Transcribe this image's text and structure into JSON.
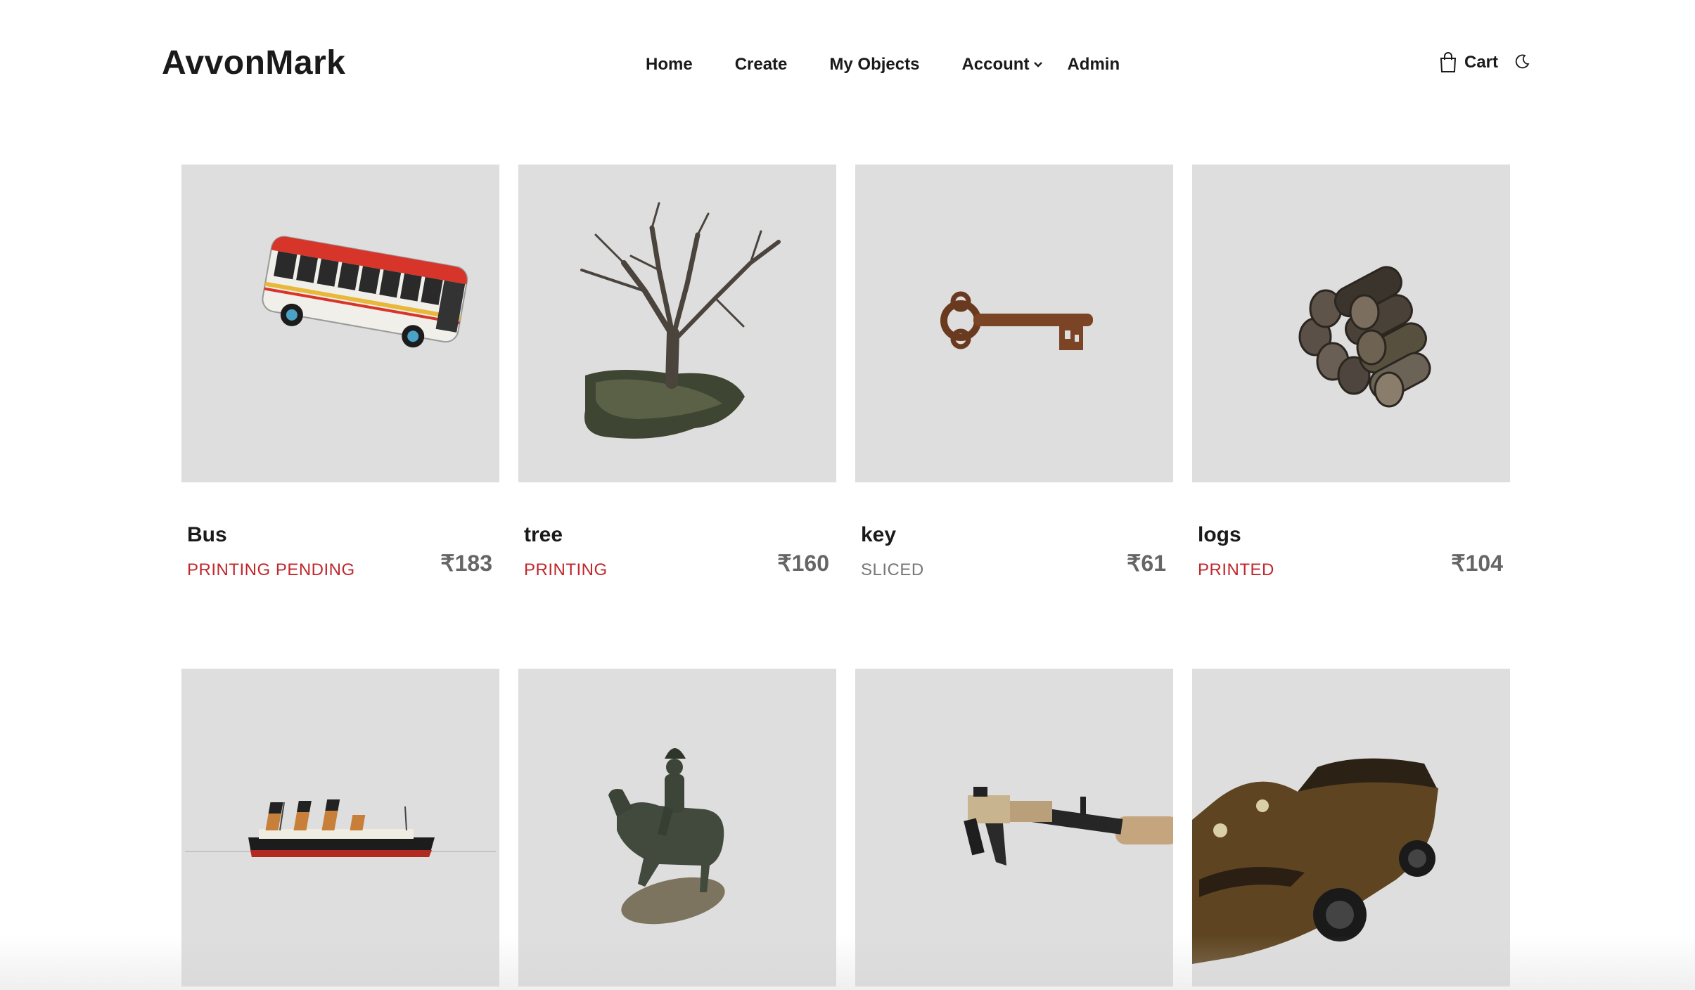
{
  "header": {
    "logo": "AvvonMark",
    "nav": [
      "Home",
      "Create",
      "My Objects",
      "Account",
      "Admin"
    ],
    "cart_label": "Cart",
    "theme_icon": "moon-icon"
  },
  "colors": {
    "status_red": "#c0282d",
    "status_gray": "#777777",
    "card_bg": "#dedede"
  },
  "objects": [
    {
      "title": "Bus",
      "status": "PRINTING PENDING",
      "price": "₹183",
      "icon": "bus-model"
    },
    {
      "title": "tree",
      "status": "PRINTING",
      "price": "₹160",
      "icon": "tree-model"
    },
    {
      "title": "key",
      "status": "SLICED",
      "price": "₹61",
      "icon": "key-model"
    },
    {
      "title": "logs",
      "status": "PRINTED",
      "price": "₹104",
      "icon": "logs-model"
    },
    {
      "title": "",
      "status": "",
      "price": "",
      "icon": "ship-model"
    },
    {
      "title": "",
      "status": "",
      "price": "",
      "icon": "horse-statue-model"
    },
    {
      "title": "",
      "status": "",
      "price": "",
      "icon": "rifle-model"
    },
    {
      "title": "",
      "status": "",
      "price": "",
      "icon": "car-model"
    }
  ]
}
